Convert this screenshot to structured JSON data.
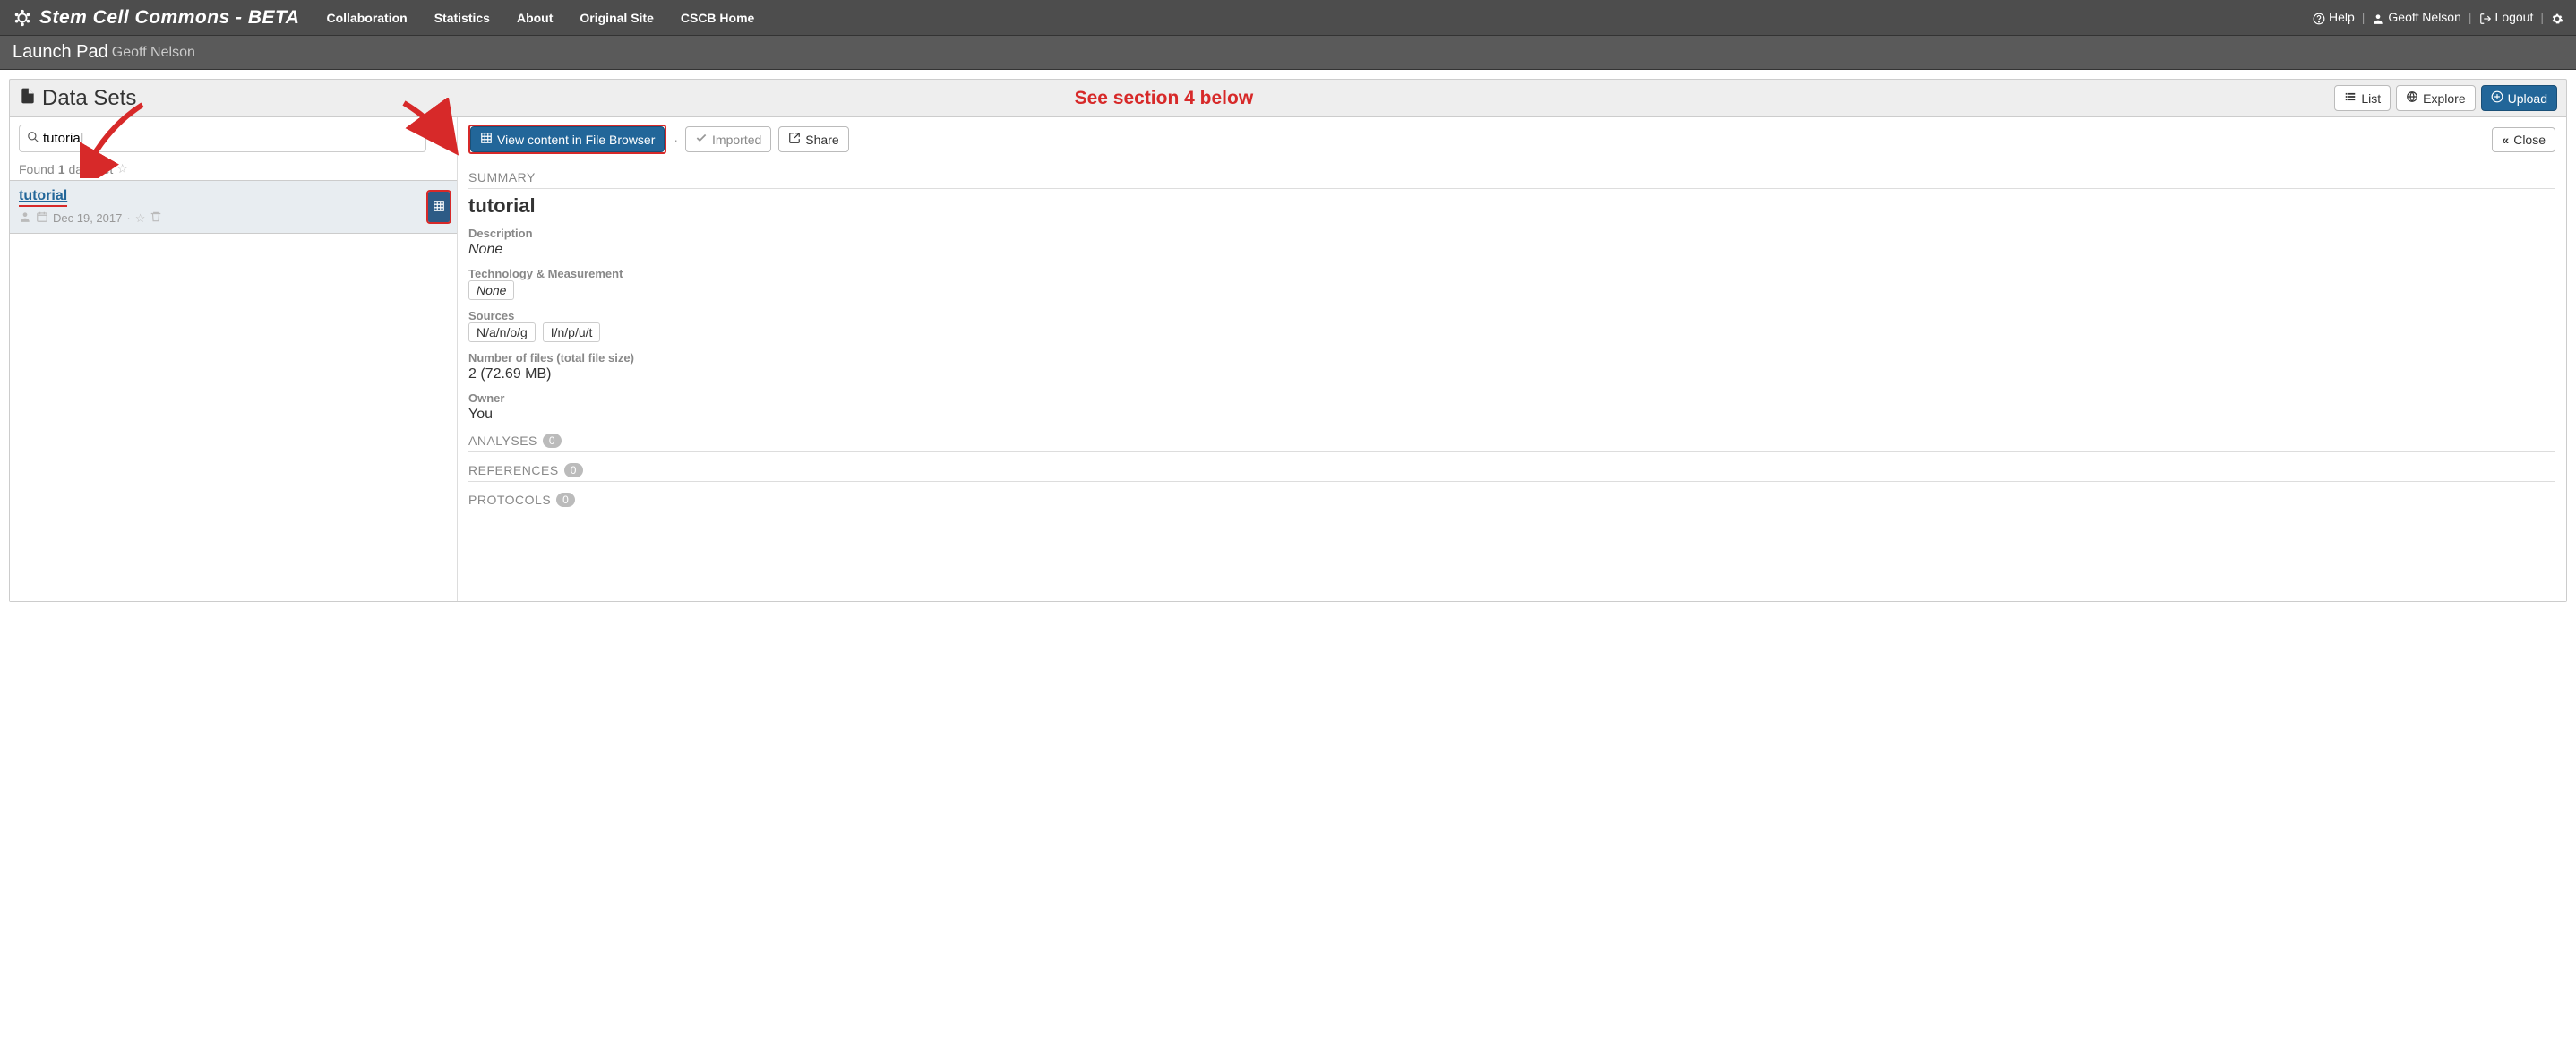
{
  "brand": "Stem Cell Commons - BETA",
  "nav": {
    "collaboration": "Collaboration",
    "statistics": "Statistics",
    "about": "About",
    "original": "Original Site",
    "cscb": "CSCB Home"
  },
  "topright": {
    "help": "Help",
    "user": "Geoff Nelson",
    "logout": "Logout"
  },
  "subheader": {
    "title": "Launch Pad",
    "user": "Geoff Nelson"
  },
  "panel": {
    "title": "Data Sets",
    "annotation": "See section 4 below",
    "buttons": {
      "list": "List",
      "explore": "Explore",
      "upload": "Upload"
    }
  },
  "search": {
    "value": "tutorial"
  },
  "found": {
    "prefix": "Found ",
    "count": "1",
    "suffix": " data set"
  },
  "dsitem": {
    "title": "tutorial",
    "date": "Dec 19, 2017"
  },
  "detail": {
    "actions": {
      "view": "View content in File Browser",
      "imported": "Imported",
      "share": "Share",
      "close": "Close"
    },
    "dot": "·",
    "summary_hdr": "SUMMARY",
    "name": "tutorial",
    "description_label": "Description",
    "description_value": "None",
    "tech_label": "Technology & Measurement",
    "tech_value": "None",
    "sources_label": "Sources",
    "source1": "N/a/n/o/g",
    "source2": "I/n/p/u/t",
    "files_label": "Number of files (total file size)",
    "files_value": "2 (72.69 MB)",
    "owner_label": "Owner",
    "owner_value": "You",
    "analyses_hdr": "ANALYSES",
    "analyses_count": "0",
    "references_hdr": "REFERENCES",
    "references_count": "0",
    "protocols_hdr": "PROTOCOLS",
    "protocols_count": "0"
  }
}
